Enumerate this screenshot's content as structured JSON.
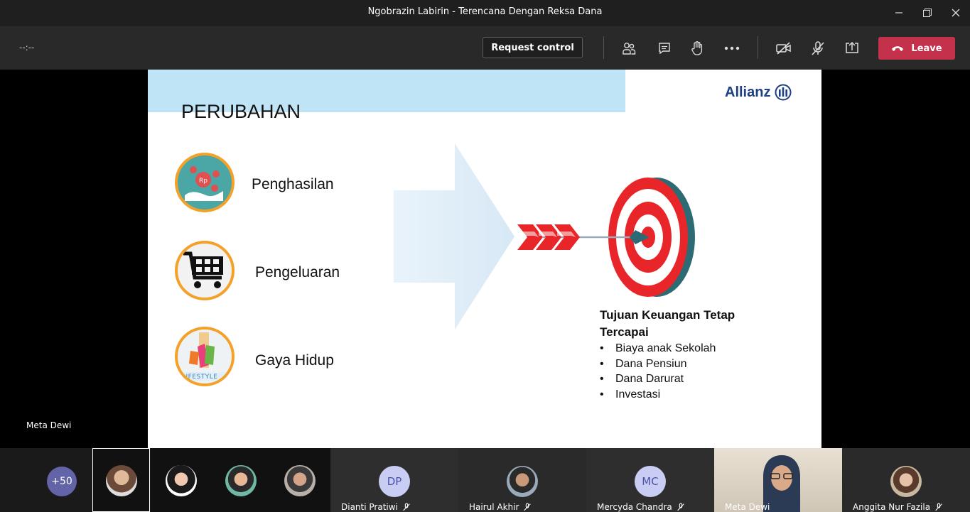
{
  "window": {
    "title": "Ngobrazin Labirin - Terencana Dengan Reksa Dana"
  },
  "toolbar": {
    "timer": "--:--",
    "request_control": "Request control",
    "leave": "Leave"
  },
  "slide": {
    "title": "PERUBAHAN",
    "logo": "Allianz",
    "items": [
      {
        "label": "Penghasilan",
        "icon": "money-hand-icon"
      },
      {
        "label": "Pengeluaran",
        "icon": "shopping-cart-icon"
      },
      {
        "label": "Gaya Hidup",
        "icon": "lifestyle-icon",
        "badge": "LIFESTYLE"
      }
    ],
    "goal_title": "Tujuan Keuangan Tetap Tercapai",
    "goals": [
      "Biaya anak Sekolah",
      "Dana Pensiun",
      "Dana Darurat",
      "Investasi"
    ]
  },
  "presenter_caption": "Meta Dewi",
  "participants": {
    "overflow": "+50",
    "tiles": [
      {
        "name": "Dianti Pratiwi",
        "initials": "DP"
      },
      {
        "name": "Hairul Akhir"
      },
      {
        "name": "Mercyda Chandra",
        "initials": "MC"
      },
      {
        "name": "Meta Dewi"
      },
      {
        "name": "Anggita Nur Fazila"
      }
    ]
  },
  "colors": {
    "leave": "#c4314b",
    "accent_orange": "#f4a12a",
    "brand_blue": "#1d3f86",
    "band_blue": "#bfe4f6",
    "target_red": "#e8262a"
  }
}
